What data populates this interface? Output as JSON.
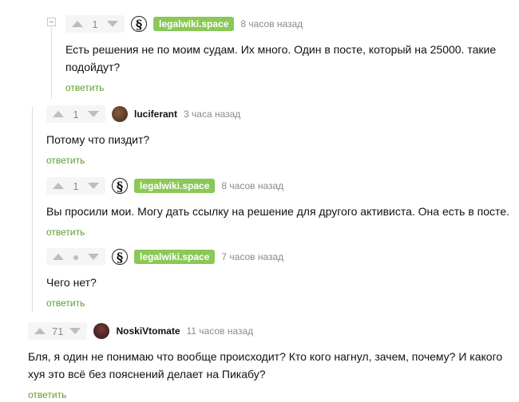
{
  "comments": [
    {
      "rating": "1",
      "author": "legalwiki.space",
      "time": "8 часов назад",
      "text": "Есть решения не по моим судам. Их много. Один в посте, который на 25000. такие подойдут?",
      "reply": "ответить"
    },
    {
      "rating": "1",
      "author": "luciferant",
      "time": "3 часа назад",
      "text": "Потому что пиздит?",
      "reply": "ответить"
    },
    {
      "rating": "1",
      "author": "legalwiki.space",
      "time": "8 часов назад",
      "text": "Вы просили мои. Могу дать ссылку на решение для другого активиста. Она есть в посте.",
      "reply": "ответить"
    },
    {
      "rating": "",
      "author": "legalwiki.space",
      "time": "7 часов назад",
      "text": "Чего нет?",
      "reply": "ответить"
    },
    {
      "rating": "71",
      "author": "NoskiVtomate",
      "time": "11 часов назад",
      "text": "Бля, я один не понимаю что вообще происходит? Кто кого нагнул, зачем, почему? И какого хуя это всё без пояснений делает на Пикабу?",
      "reply": "ответить"
    }
  ],
  "icons": {
    "legalwiki_avatar": "section-sign-icon",
    "luciferant_avatar": "user-photo-icon",
    "noskivtomate_avatar": "user-photo-icon"
  }
}
